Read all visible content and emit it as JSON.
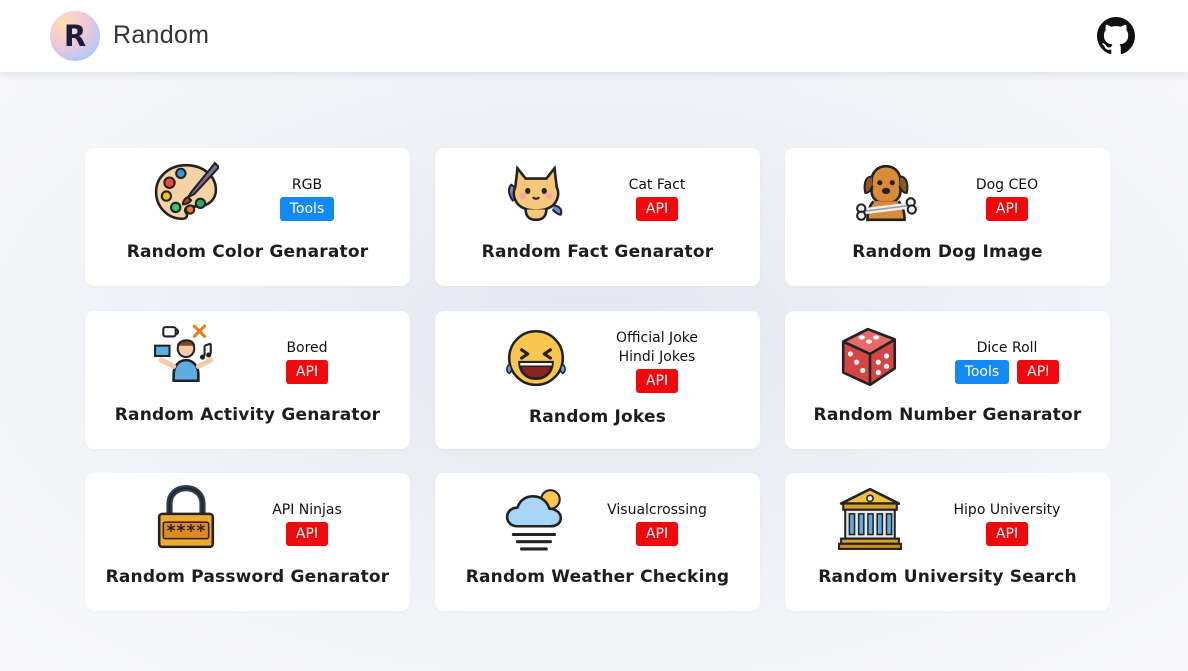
{
  "navbar": {
    "logo_letter": "R",
    "brand": "Random"
  },
  "cards": [
    {
      "title": "Random Color Genarator",
      "sources": [
        "RGB"
      ],
      "badges": [
        {
          "label": "Tools",
          "kind": "tools"
        }
      ],
      "icon": "palette-icon"
    },
    {
      "title": "Random Fact Genarator",
      "sources": [
        "Cat Fact"
      ],
      "badges": [
        {
          "label": "API",
          "kind": "api"
        }
      ],
      "icon": "cat-icon"
    },
    {
      "title": "Random Dog Image",
      "sources": [
        "Dog CEO"
      ],
      "badges": [
        {
          "label": "API",
          "kind": "api"
        }
      ],
      "icon": "dog-icon"
    },
    {
      "title": "Random Activity Genarator",
      "sources": [
        "Bored"
      ],
      "badges": [
        {
          "label": "API",
          "kind": "api"
        }
      ],
      "icon": "activity-person-icon"
    },
    {
      "title": "Random Jokes",
      "sources": [
        "Official Joke",
        "Hindi Jokes"
      ],
      "badges": [
        {
          "label": "API",
          "kind": "api"
        }
      ],
      "icon": "laughing-emoji-icon"
    },
    {
      "title": "Random Number Genarator",
      "sources": [
        "Dice Roll"
      ],
      "badges": [
        {
          "label": "Tools",
          "kind": "tools"
        },
        {
          "label": "API",
          "kind": "api"
        }
      ],
      "icon": "dice-icon"
    },
    {
      "title": "Random Password Genarator",
      "sources": [
        "API Ninjas"
      ],
      "badges": [
        {
          "label": "API",
          "kind": "api"
        }
      ],
      "icon": "padlock-icon"
    },
    {
      "title": "Random Weather Checking",
      "sources": [
        "Visualcrossing"
      ],
      "badges": [
        {
          "label": "API",
          "kind": "api"
        }
      ],
      "icon": "weather-cloud-icon"
    },
    {
      "title": "Random University Search",
      "sources": [
        "Hipo University"
      ],
      "badges": [
        {
          "label": "API",
          "kind": "api"
        }
      ],
      "icon": "university-icon"
    }
  ],
  "colors": {
    "tools_badge": "#1389f5",
    "api_badge": "#f0080c",
    "background": "#f3f4f8"
  }
}
